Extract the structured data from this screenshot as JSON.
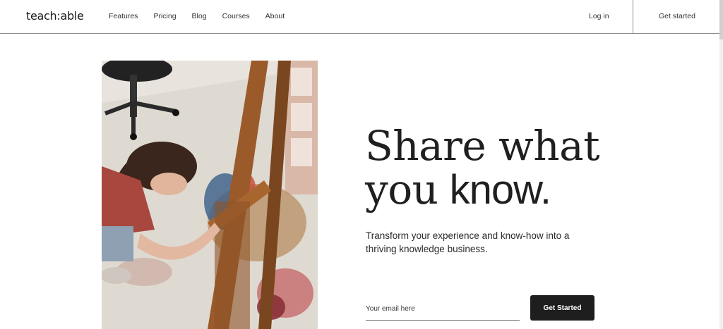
{
  "header": {
    "logo": "teach:able",
    "nav": [
      "Features",
      "Pricing",
      "Blog",
      "Courses",
      "About"
    ],
    "login": "Log in",
    "get_started": "Get started"
  },
  "hero": {
    "headline_line1": "Share what",
    "headline_line2_serif": "you",
    "headline_line2_sans": "know.",
    "subtitle": "Transform your experience and know-how into a thriving knowledge business.",
    "email_placeholder": "Your email here",
    "cta_label": "Get Started",
    "image_icon": "artist-painting-photo"
  },
  "colors": {
    "text": "#1f1f1f",
    "button_bg": "#1e1e1e",
    "button_text": "#ffffff",
    "divider": "#8c8c8c"
  }
}
